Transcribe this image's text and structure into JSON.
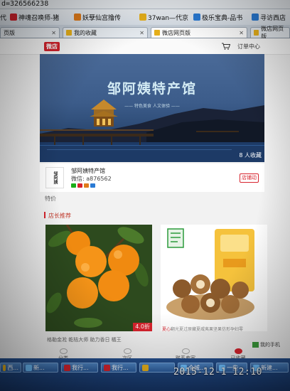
{
  "browser": {
    "address": "d=326566238",
    "bookmarks": [
      {
        "label": "代",
        "color": "#d7232d"
      },
      {
        "label": "神魂召唤师-猪",
        "color": "#d7232d"
      },
      {
        "label": "妖孽仙宫撸传",
        "color": "#e07b1a"
      },
      {
        "label": "37wan—代京",
        "color": "#e8b11b"
      },
      {
        "label": "极乐宝典-品书",
        "color": "#2a7bd5"
      },
      {
        "label": "寻访西店",
        "color": "#2a7bd5"
      }
    ],
    "tabs": [
      {
        "label": "页版",
        "active": false
      },
      {
        "label": "我的收藏",
        "active": false
      },
      {
        "label": "微店网页版",
        "active": true
      },
      {
        "label": "微店网页版",
        "active": false
      }
    ]
  },
  "header": {
    "logo": "微店",
    "orders": "订单中心"
  },
  "banner": {
    "title": "邹阿姨特产馆",
    "subtitle": "—— 特色美食 人文体验 ——",
    "favorites": "8 人收藏"
  },
  "shop": {
    "avatar_text": "邹阿姨",
    "name": "邹阿姨特产馆",
    "wechat": "微信: a876562",
    "notice_btn": "店铺动"
  },
  "tejia": "特价",
  "recommend": {
    "title": "店长推荐"
  },
  "products": [
    {
      "caption": "格勒金凇 乾桔大师 助力香日 橘王",
      "discount": "4.0折"
    },
    {
      "caption_red": "夏心",
      "caption": "翻光夏过原藏夏威夷果坚果仿形孕妇零"
    }
  ],
  "bottom_nav": [
    "分类",
    "次区",
    "联系卖家",
    "已收藏"
  ],
  "mobile": "我的手机",
  "taskbar": [
    {
      "label": "西...",
      "color": "#e8b11b"
    },
    {
      "label": "新...",
      "color": "#6ec0ff"
    },
    {
      "label": "我行...",
      "color": "#d7232d"
    },
    {
      "label": "我行...",
      "color": "#d7232d"
    },
    {
      "label": "",
      "color": "#e8b11b"
    },
    {
      "label": "全城...",
      "color": "#6ec0ff"
    },
    {
      "label": "一些",
      "color": "#6ec0ff"
    },
    {
      "label": "新建...",
      "color": "#6ec0ff"
    }
  ],
  "timestamp": "2015-12-1 12:10"
}
